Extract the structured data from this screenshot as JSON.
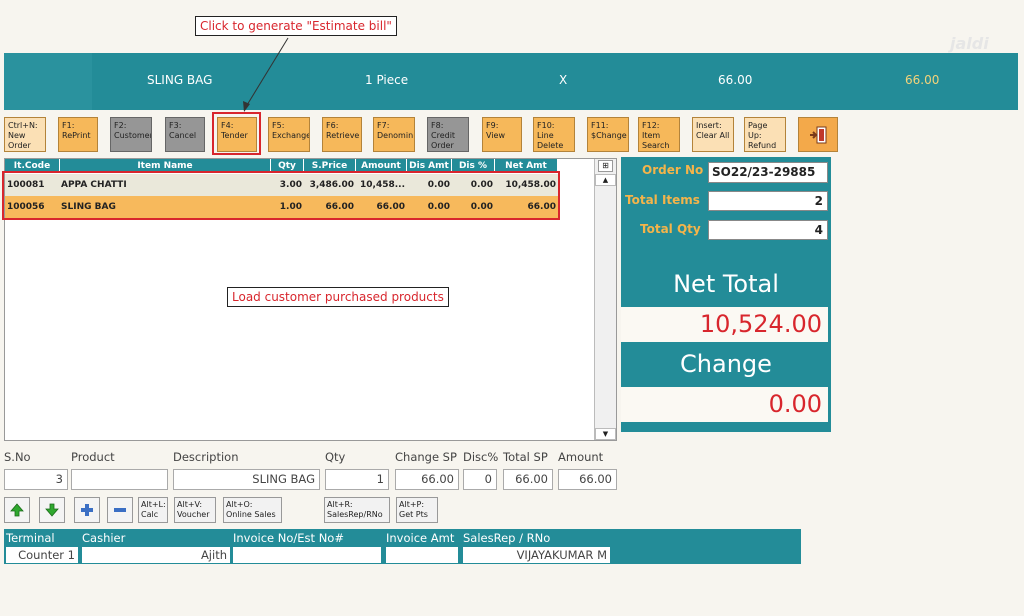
{
  "annotations": {
    "top": "Click to generate \"Estimate bill\"",
    "middle": "Load customer purchased products"
  },
  "watermark": "jaldi",
  "banner": {
    "item": "SLING BAG",
    "qty": "1 Piece",
    "x": "X",
    "price": "66.00",
    "total": "66.00"
  },
  "toolbar": [
    {
      "key": "ctrl-n",
      "label": "Ctrl+N:\nNew\nOrder"
    },
    {
      "key": "f1",
      "label": "F1:\nRePrint"
    },
    {
      "key": "f2",
      "label": "F2:\nCustomer"
    },
    {
      "key": "f3",
      "label": "F3:\nCancel"
    },
    {
      "key": "f4",
      "label": "F4:\nTender"
    },
    {
      "key": "f5",
      "label": "F5:\nExchange"
    },
    {
      "key": "f6",
      "label": "F6:\nRetrieve"
    },
    {
      "key": "f7",
      "label": "F7:\nDenomin"
    },
    {
      "key": "f8",
      "label": "F8:\nCredit\nOrder"
    },
    {
      "key": "f9",
      "label": "F9:\nView"
    },
    {
      "key": "f10",
      "label": "F10:\nLine\nDelete"
    },
    {
      "key": "f11",
      "label": "F11:\n$Change"
    },
    {
      "key": "f12",
      "label": "F12:\nItem\nSearch"
    },
    {
      "key": "insert",
      "label": "Insert:\nClear All"
    },
    {
      "key": "pageup",
      "label": "Page Up:\nRefund"
    }
  ],
  "grid": {
    "headers": [
      "It.Code",
      "Item Name",
      "Qty",
      "S.Price",
      "Amount",
      "Dis Amt",
      "Dis %",
      "Net Amt"
    ],
    "rows": [
      [
        "100081",
        "APPA CHATTI",
        "3.00",
        "3,486.00",
        "10,458...",
        "0.00",
        "0.00",
        "10,458.00"
      ],
      [
        "100056",
        "SLING BAG",
        "1.00",
        "66.00",
        "66.00",
        "0.00",
        "0.00",
        "66.00"
      ]
    ]
  },
  "summary": {
    "order_no_label": "Order No",
    "order_no": "SO22/23-29885",
    "total_items_label": "Total Items",
    "total_items": "2",
    "total_qty_label": "Total Qty",
    "total_qty": "4",
    "net_total_label": "Net Total",
    "net_total": "10,524.00",
    "change_label": "Change",
    "change": "0.00"
  },
  "entry": {
    "labels": [
      "S.No",
      "Product",
      "Description",
      "Qty",
      "Change SP",
      "Disc%",
      "Total SP",
      "Amount"
    ],
    "sno": "3",
    "product": "",
    "description": "SLING BAG",
    "qty": "1",
    "change_sp": "66.00",
    "disc": "0",
    "total_sp": "66.00",
    "amount": "66.00"
  },
  "small_buttons": {
    "calc": "Alt+L:\nCalc",
    "voucher": "Alt+V:\nVoucher",
    "online": "Alt+O:\nOnline Sales",
    "salesrep": "Alt+R:\nSalesRep/RNo",
    "getpts": "Alt+P:\nGet Pts"
  },
  "footer": {
    "terminal_label": "Terminal",
    "cashier_label": "Cashier",
    "invoice_no_label": "Invoice No/Est No#",
    "invoice_amt_label": "Invoice Amt",
    "salesrep_label": "SalesRep / RNo",
    "terminal": "Counter 1",
    "cashier": "Ajith",
    "invoice_no": "",
    "invoice_amt": "",
    "salesrep": "VIJAYAKUMAR M"
  },
  "colors": {
    "teal": "#238c98",
    "orange": "#f6b85a",
    "red": "#d8262d"
  }
}
